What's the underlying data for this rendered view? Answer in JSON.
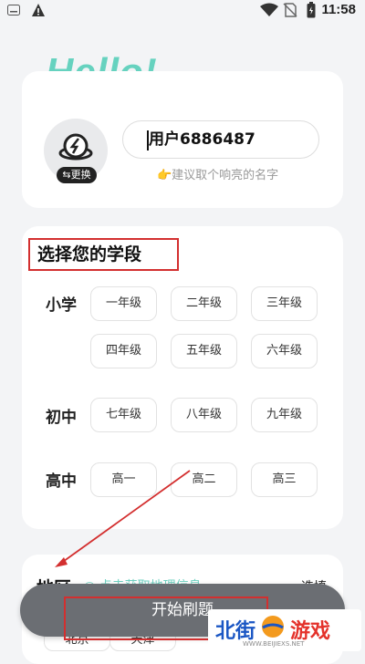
{
  "status": {
    "time": "11:58"
  },
  "header": {
    "greeting": "Hello!"
  },
  "profile": {
    "swap_label": "⇆更换",
    "username": "用户6886487",
    "hint": "👉建议取个响亮的名字"
  },
  "grade_section": {
    "title": "选择您的学段",
    "groups": [
      {
        "label": "小学",
        "grades": [
          "一年级",
          "二年级",
          "三年级",
          "四年级",
          "五年级",
          "六年级"
        ]
      },
      {
        "label": "初中",
        "grades": [
          "七年级",
          "八年级",
          "九年级"
        ]
      },
      {
        "label": "高中",
        "grades": [
          "高一",
          "高二",
          "高三"
        ]
      }
    ]
  },
  "location": {
    "title": "地区",
    "link": "◎ 点击获取地理信息",
    "select": "选填",
    "chips": [
      "北京",
      "天津"
    ]
  },
  "start_button": {
    "label": "开始刷题"
  },
  "watermark": {
    "text1": "北街",
    "text2": "游戏",
    "url": "WWW.BEIJIEXS.NET"
  },
  "colors": {
    "accent": "#66d2bf",
    "annotation": "#d32f2f",
    "button": "#6b6e73"
  }
}
